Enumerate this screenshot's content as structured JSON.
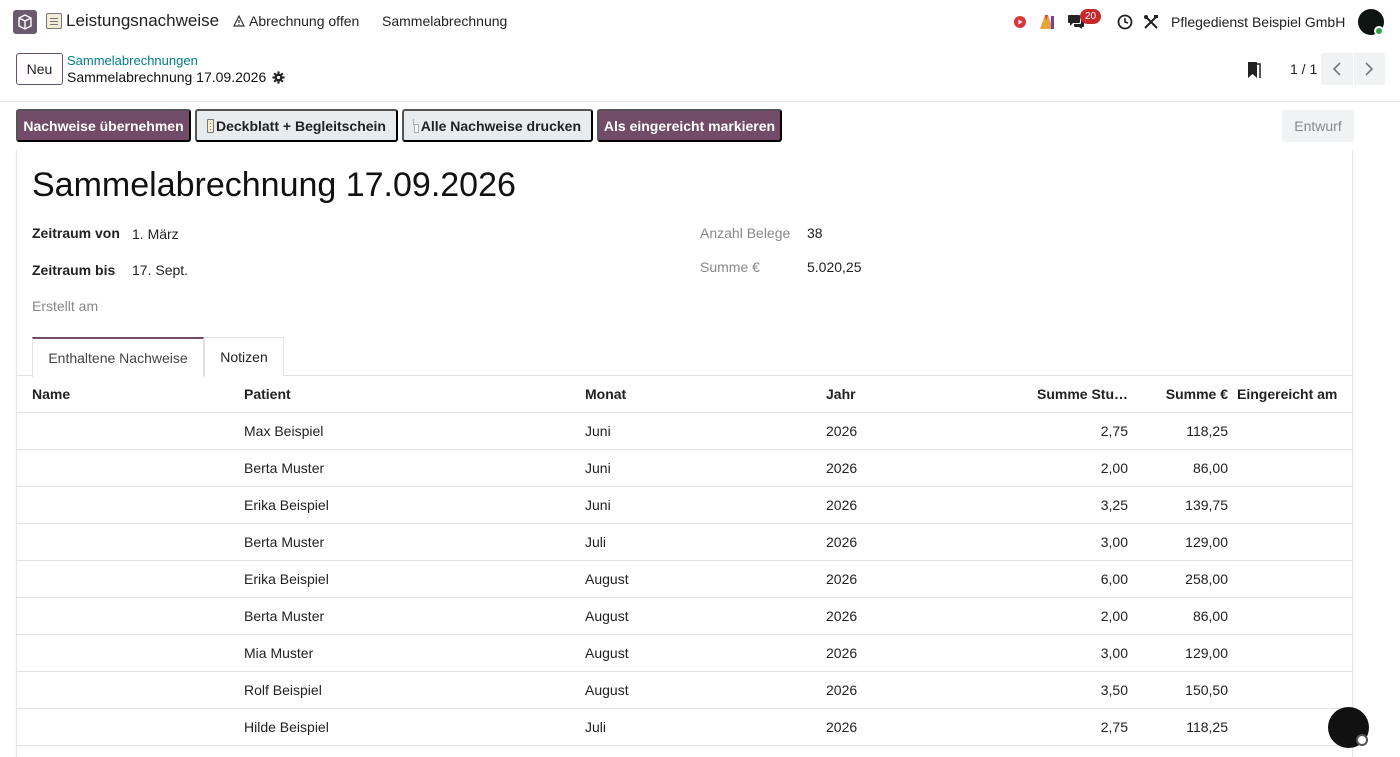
{
  "navbar": {
    "app_title": "Leistungsnachweise",
    "menu": [
      "Abrechnung offen",
      "Sammelabrechnung"
    ],
    "messages_count": "20",
    "company": "Pflegedienst Beispiel GmbH"
  },
  "control": {
    "new_label": "Neu",
    "breadcrumb_parent": "Sammelabrechnungen",
    "breadcrumb_current": "Sammelabrechnung 17.09.2026",
    "pager": "1 / 1"
  },
  "actions": {
    "take_over": "Nachweise übernehmen",
    "cover_sheet": "Deckblatt + Begleitschein",
    "print_all": "Alle Nachweise drucken",
    "mark_submitted": "Als eingereicht markieren",
    "status": "Entwurf"
  },
  "form": {
    "title": "Sammelabrechnung 17.09.2026",
    "period_from_label": "Zeitraum von",
    "period_from": "1. März",
    "period_to_label": "Zeitraum bis",
    "period_to": "17. Sept.",
    "created_label": "Erstellt am",
    "count_label": "Anzahl Belege",
    "count": "38",
    "sum_label": "Summe €",
    "sum": "5.020,25"
  },
  "tabs": [
    "Enthaltene Nachweise",
    "Notizen"
  ],
  "table": {
    "headers": [
      "Name",
      "Patient",
      "Monat",
      "Jahr",
      "Summe Stu…",
      "Summe €",
      "Eingereicht am"
    ],
    "rows": [
      {
        "name": "",
        "patient": "Max Beispiel",
        "month": "Juni",
        "year": "2026",
        "hours": "2,75",
        "sum": "118,25",
        "submitted": ""
      },
      {
        "name": "",
        "patient": "Berta Muster",
        "month": "Juni",
        "year": "2026",
        "hours": "2,00",
        "sum": "86,00",
        "submitted": ""
      },
      {
        "name": "",
        "patient": "Erika Beispiel",
        "month": "Juni",
        "year": "2026",
        "hours": "3,25",
        "sum": "139,75",
        "submitted": ""
      },
      {
        "name": "",
        "patient": "Berta Muster",
        "month": "Juli",
        "year": "2026",
        "hours": "3,00",
        "sum": "129,00",
        "submitted": ""
      },
      {
        "name": "",
        "patient": "Erika Beispiel",
        "month": "August",
        "year": "2026",
        "hours": "6,00",
        "sum": "258,00",
        "submitted": ""
      },
      {
        "name": "",
        "patient": "Berta Muster",
        "month": "August",
        "year": "2026",
        "hours": "2,00",
        "sum": "86,00",
        "submitted": ""
      },
      {
        "name": "",
        "patient": "Mia Muster",
        "month": "August",
        "year": "2026",
        "hours": "3,00",
        "sum": "129,00",
        "submitted": ""
      },
      {
        "name": "",
        "patient": "Rolf Beispiel",
        "month": "August",
        "year": "2026",
        "hours": "3,50",
        "sum": "150,50",
        "submitted": ""
      },
      {
        "name": "",
        "patient": "Hilde Beispiel",
        "month": "Juli",
        "year": "2026",
        "hours": "2,75",
        "sum": "118,25",
        "submitted": ""
      }
    ]
  },
  "colors": {
    "primary": "#714b67",
    "link": "#017e84",
    "badge": "#c9272b",
    "online": "#28a745"
  }
}
